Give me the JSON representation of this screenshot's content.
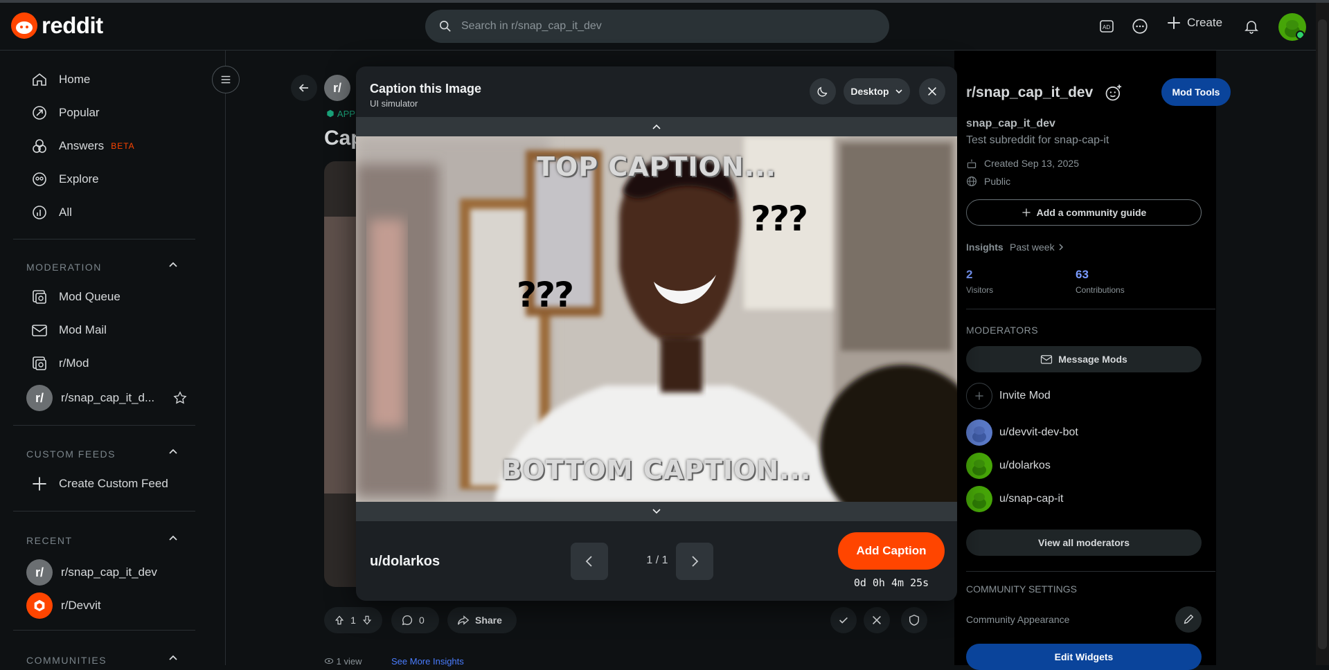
{
  "header": {
    "logo_text": "reddit",
    "search_placeholder": "Search in r/snap_cap_it_dev",
    "create_label": "Create"
  },
  "left_nav": {
    "items": [
      {
        "label": "Home"
      },
      {
        "label": "Popular"
      },
      {
        "label": "Answers",
        "badge": "BETA"
      },
      {
        "label": "Explore"
      },
      {
        "label": "All"
      }
    ],
    "moderation": {
      "title": "MODERATION",
      "items": [
        {
          "label": "Mod Queue"
        },
        {
          "label": "Mod Mail"
        },
        {
          "label": "r/Mod"
        },
        {
          "label": "r/snap_cap_it_d..."
        }
      ]
    },
    "custom_feeds": {
      "title": "CUSTOM FEEDS",
      "create_label": "Create Custom Feed"
    },
    "recent": {
      "title": "RECENT",
      "items": [
        {
          "label": "r/snap_cap_it_dev"
        },
        {
          "label": "r/Devvit"
        }
      ]
    },
    "communities_title": "COMMUNITIES",
    "sub_avatar_text": "r/"
  },
  "post": {
    "app_tag": "APP",
    "title_partial": "Cap",
    "votes": "1",
    "comments": "0",
    "share_label": "Share",
    "views": "1 view",
    "insights_link": "See More Insights"
  },
  "modal": {
    "title": "Caption this Image",
    "subtitle": "UI simulator",
    "device_label": "Desktop",
    "top_caption": "TOP CAPTION...",
    "bottom_caption": "BOTTOM CAPTION...",
    "question_marks": "???",
    "username": "u/dolarkos",
    "page_indicator": "1 / 1",
    "add_caption_label": "Add Caption",
    "timer": "0d 0h 4m 25s"
  },
  "right_sidebar": {
    "community": "r/snap_cap_it_dev",
    "mod_tools_label": "Mod Tools",
    "name": "snap_cap_it_dev",
    "description": "Test subreddit for snap-cap-it",
    "created": "Created Sep 13, 2025",
    "visibility": "Public",
    "add_guide_label": "Add a community guide",
    "insights_label": "Insights",
    "insights_period": "Past week",
    "visitors_value": "2",
    "visitors_label": "Visitors",
    "contributions_value": "63",
    "contributions_label": "Contributions",
    "moderators_title": "MODERATORS",
    "message_mods_label": "Message Mods",
    "invite_mod_label": "Invite Mod",
    "moderators": [
      {
        "name": "u/devvit-dev-bot"
      },
      {
        "name": "u/dolarkos"
      },
      {
        "name": "u/snap-cap-it"
      }
    ],
    "view_all_mods_label": "View all moderators",
    "community_settings_title": "COMMUNITY SETTINGS",
    "community_appearance_label": "Community Appearance",
    "edit_widgets_label": "Edit Widgets"
  },
  "colors": {
    "accent": "#ff4500",
    "mod_tools_blue": "#0a449b",
    "background": "#0e1113",
    "link_blue": "#4a7dff"
  }
}
